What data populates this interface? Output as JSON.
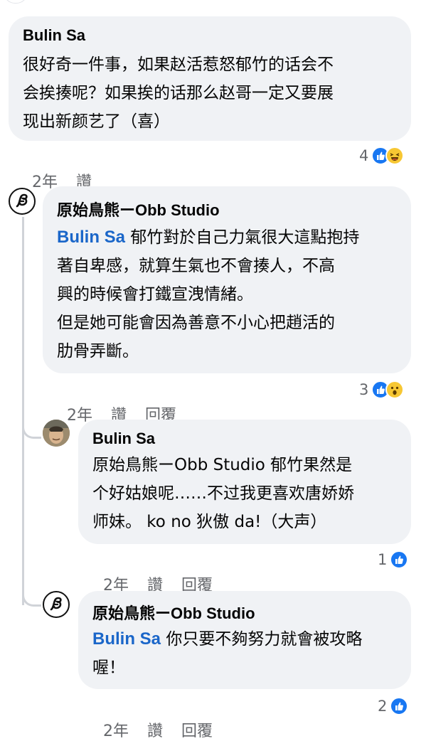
{
  "comments": [
    {
      "author": "Bulin Sa",
      "text": "很好奇一件事，如果赵活惹怒郁竹的话会不\n会挨揍呢？如果挨的话那么赵哥一定又要展\n现出新颜艺了（喜）",
      "time": "2年",
      "like_label": "讚",
      "reaction_count": "4",
      "reaction_icons": [
        "like-icon",
        "laughing-emoji-icon"
      ]
    },
    {
      "author": "原始鳥熊ーObb Studio",
      "mention": "Bulin Sa",
      "text_line1": " 郁竹對於自己力氣很大這點抱持",
      "text_rest": "著自卑感，就算生氣也不會揍人，不高\n興的時候會打鐵宣洩情緒。\n但是她可能會因為善意不小心把趙活的\n肋骨弄斷。",
      "time": "2年",
      "like_label": "讚",
      "reply_label": "回覆",
      "reaction_count": "3",
      "reaction_icons": [
        "like-icon",
        "surprised-emoji-icon"
      ]
    },
    {
      "author": "Bulin Sa",
      "text": "原始鳥熊ーObb Studio 郁竹果然是\n个好姑娘呢……不过我更喜欢唐娇娇\n师妹。 ko no 狄傲 da!（大声）",
      "time": "2年",
      "like_label": "讚",
      "reply_label": "回覆",
      "reaction_count": "1",
      "reaction_icons": [
        "like-icon"
      ]
    },
    {
      "author": "原始鳥熊ーObb Studio",
      "mention": "Bulin Sa",
      "text_line1": " 你只要不夠努力就會被攻略",
      "text_rest": "喔！",
      "time": "2年",
      "like_label": "讚",
      "reply_label": "回覆",
      "reaction_count": "2",
      "reaction_icons": [
        "like-icon"
      ]
    }
  ],
  "colors": {
    "bubble": "#f0f2f5",
    "mention": "#1a66c9",
    "meta": "#65676b",
    "like": "#1877f2"
  }
}
